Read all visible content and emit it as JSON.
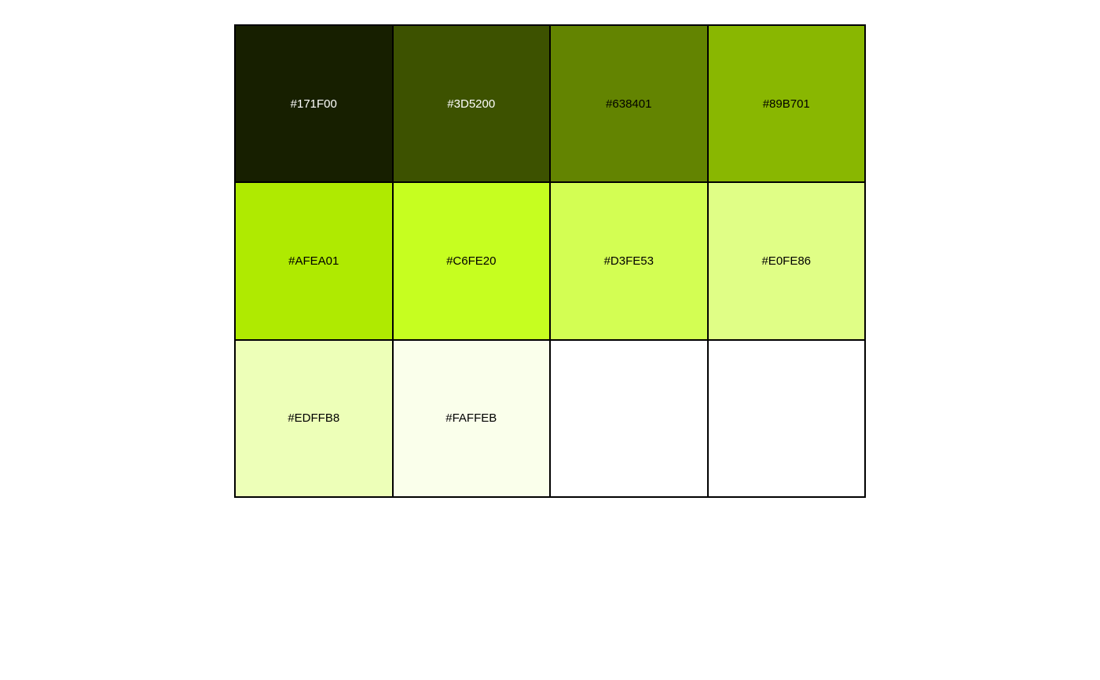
{
  "swatches": [
    {
      "label": "#171F00",
      "color": "#171F00",
      "text_color": "#ffffff"
    },
    {
      "label": "#3D5200",
      "color": "#3D5200",
      "text_color": "#ffffff"
    },
    {
      "label": "#638401",
      "color": "#638401",
      "text_color": "#000000"
    },
    {
      "label": "#89B701",
      "color": "#89B701",
      "text_color": "#000000"
    },
    {
      "label": "#AFEA01",
      "color": "#AFEA01",
      "text_color": "#000000"
    },
    {
      "label": "#C6FE20",
      "color": "#C6FE20",
      "text_color": "#000000"
    },
    {
      "label": "#D3FE53",
      "color": "#D3FE53",
      "text_color": "#000000"
    },
    {
      "label": "#E0FE86",
      "color": "#E0FE86",
      "text_color": "#000000"
    },
    {
      "label": "#EDFFB8",
      "color": "#EDFFB8",
      "text_color": "#000000"
    },
    {
      "label": "#FAFFEB",
      "color": "#FAFFEB",
      "text_color": "#000000"
    },
    {
      "label": "",
      "color": "#FFFFFF",
      "text_color": "#000000"
    },
    {
      "label": "",
      "color": "#FFFFFF",
      "text_color": "#000000"
    }
  ]
}
